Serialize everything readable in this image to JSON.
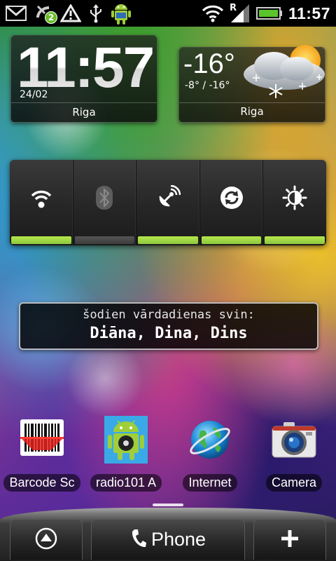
{
  "status_bar": {
    "time": "11:57",
    "notification_badge": "2",
    "signal_type_label": "R",
    "icons": [
      "gmail-icon",
      "missed-call-icon",
      "warning-icon",
      "usb-icon",
      "android-debug-icon",
      "wifi-icon",
      "signal-icon",
      "battery-icon"
    ],
    "battery_color": "#5ac42a"
  },
  "clock_widget": {
    "time": "11:57",
    "date": "24/02",
    "city": "Riga"
  },
  "weather_widget": {
    "temperature": "-16°",
    "range": "-8° / -16°",
    "city": "Riga",
    "condition_icon": "snow-cloud-sun-icon"
  },
  "power_control": {
    "toggles": [
      {
        "name": "wifi",
        "icon": "wifi-icon",
        "on": true
      },
      {
        "name": "bluetooth",
        "icon": "bluetooth-icon",
        "on": false
      },
      {
        "name": "gps",
        "icon": "gps-icon",
        "on": true
      },
      {
        "name": "sync",
        "icon": "sync-icon",
        "on": true
      },
      {
        "name": "brightness",
        "icon": "brightness-icon",
        "on": true
      }
    ],
    "accent_color": "#8cc63f"
  },
  "nameday": {
    "title": "šodien vārdadienas svin:",
    "names": "Diāna, Dina, Dins"
  },
  "apps": [
    {
      "label": "Barcode Sc",
      "icon": "barcode-scanner-icon"
    },
    {
      "label": "radio101 A",
      "icon": "android-radio-icon"
    },
    {
      "label": "Internet",
      "icon": "globe-icon"
    },
    {
      "label": "Camera",
      "icon": "camera-icon"
    }
  ],
  "dock": {
    "phone_label": "Phone",
    "left_icon": "up-arrow-icon",
    "right_icon": "plus-icon"
  }
}
